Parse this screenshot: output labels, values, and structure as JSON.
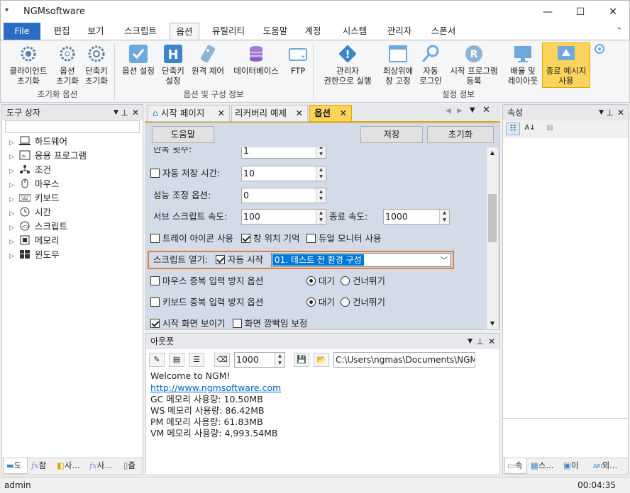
{
  "window": {
    "title": "NGMsoftware",
    "quick_access": "▾"
  },
  "menus": [
    "File",
    "편집",
    "보기",
    "스크립트",
    "옵션",
    "유틸리티",
    "도움말",
    "계정",
    "시스템",
    "관리자",
    "스폰서"
  ],
  "ribbon": {
    "group1": {
      "label": "초기화 옵션",
      "buttons": [
        "클라이언트\n초기화",
        "옵션\n초기화",
        "단축키\n초기화"
      ]
    },
    "group2": {
      "label": "옵션 및 구성 정보",
      "buttons": [
        "옵션 설정",
        "단축키\n설정",
        "원격 제어",
        "데이터베이스",
        "FTP"
      ]
    },
    "group3": {
      "label": "설정 정보",
      "buttons": [
        "관리자\n권한으로 실행",
        "최상위에\n창 고정",
        "자동\n로그인",
        "시작 프로그램\n등록",
        "배율 및\n레이아웃",
        "종료 메시지\n사용"
      ]
    },
    "btn_labels": {
      "b1": "클라이언트",
      "b1b": "초기화",
      "b2": "옵션",
      "b2b": "초기화",
      "b3": "단축키",
      "b3b": "초기화",
      "b4": "옵션 설정",
      "b5": "단축키",
      "b5b": "설정",
      "b6": "원격 제어",
      "b7": "데이터베이스",
      "b8": "FTP",
      "b9": "관리자",
      "b9b": "권한으로 실행",
      "b10": "최상위에",
      "b10b": "창 고정",
      "b11": "자동",
      "b11b": "로그인",
      "b12": "시작 프로그램",
      "b12b": "등록",
      "b13": "배율 및",
      "b13b": "레이아웃",
      "b14": "종료 메시지",
      "b14b": "사용"
    }
  },
  "toolbox": {
    "title": "도구 상자",
    "items": [
      "하드웨어",
      "응용 프로그램",
      "조건",
      "마우스",
      "키보드",
      "시간",
      "스크립트",
      "메모리",
      "윈도우"
    ],
    "bottom_tabs": [
      "도",
      "함",
      "사...",
      "사...",
      "즐"
    ]
  },
  "doc_tabs": [
    {
      "label": "시작 페이지"
    },
    {
      "label": "리커버리 예제"
    },
    {
      "label": "옵션"
    }
  ],
  "options": {
    "help_btn": "도움말",
    "save_btn": "저장",
    "reset_btn": "초기화",
    "repeat_label": "반복 횟수:",
    "repeat_value": "1",
    "autosave_label": "자동 저장 시간:",
    "autosave_value": "10",
    "perf_label": "성능 조정 옵션:",
    "perf_value": "0",
    "sub_speed_label": "서브 스크립트 속도:",
    "sub_speed_value": "100",
    "end_speed_label": "종료 속도:",
    "end_speed_value": "1000",
    "tray_label": "트레이 아이콘 사용",
    "winpos_label": "창 위치 기억",
    "dual_label": "듀얼 모니터 사용",
    "script_open_label": "스크립트 열기:",
    "autostart_label": "자동 시작",
    "autostart_select": "01. 테스트 전 환경 구성",
    "mouse_dup_label": "마우스 중복 입력 방지 옵션",
    "kbd_dup_label": "키보드 중복 입력 방지 옵션",
    "wait_label": "대기",
    "skip_label": "건너뛰기",
    "show_start_label": "시작 화면 보이기",
    "flicker_label": "화면 깜빡임 보정"
  },
  "output": {
    "title": "아웃풋",
    "count": "1000",
    "path": "C:\\Users\\ngmas\\Documents\\NGM6\\",
    "lines": [
      "Welcome to NGM!",
      "http://www.ngmsoftware.com",
      "GC 메모리 사용량: 10.50MB",
      "WS 메모리 사용량: 86.42MB",
      "PM 메모리 사용량: 61.83MB",
      "VM 메모리 사용량: 4,993.54MB"
    ]
  },
  "properties": {
    "title": "속성",
    "bottom_tabs": [
      "속",
      "스...",
      "이",
      "외..."
    ]
  },
  "status": {
    "user": "admin",
    "time": "00:04:35"
  },
  "colors": {
    "accent": "#2b6cc4",
    "highlight": "#e07b39",
    "selection": "#0078d7",
    "active_btn": "#fcd45c",
    "options_bg": "#d4dbe8"
  }
}
